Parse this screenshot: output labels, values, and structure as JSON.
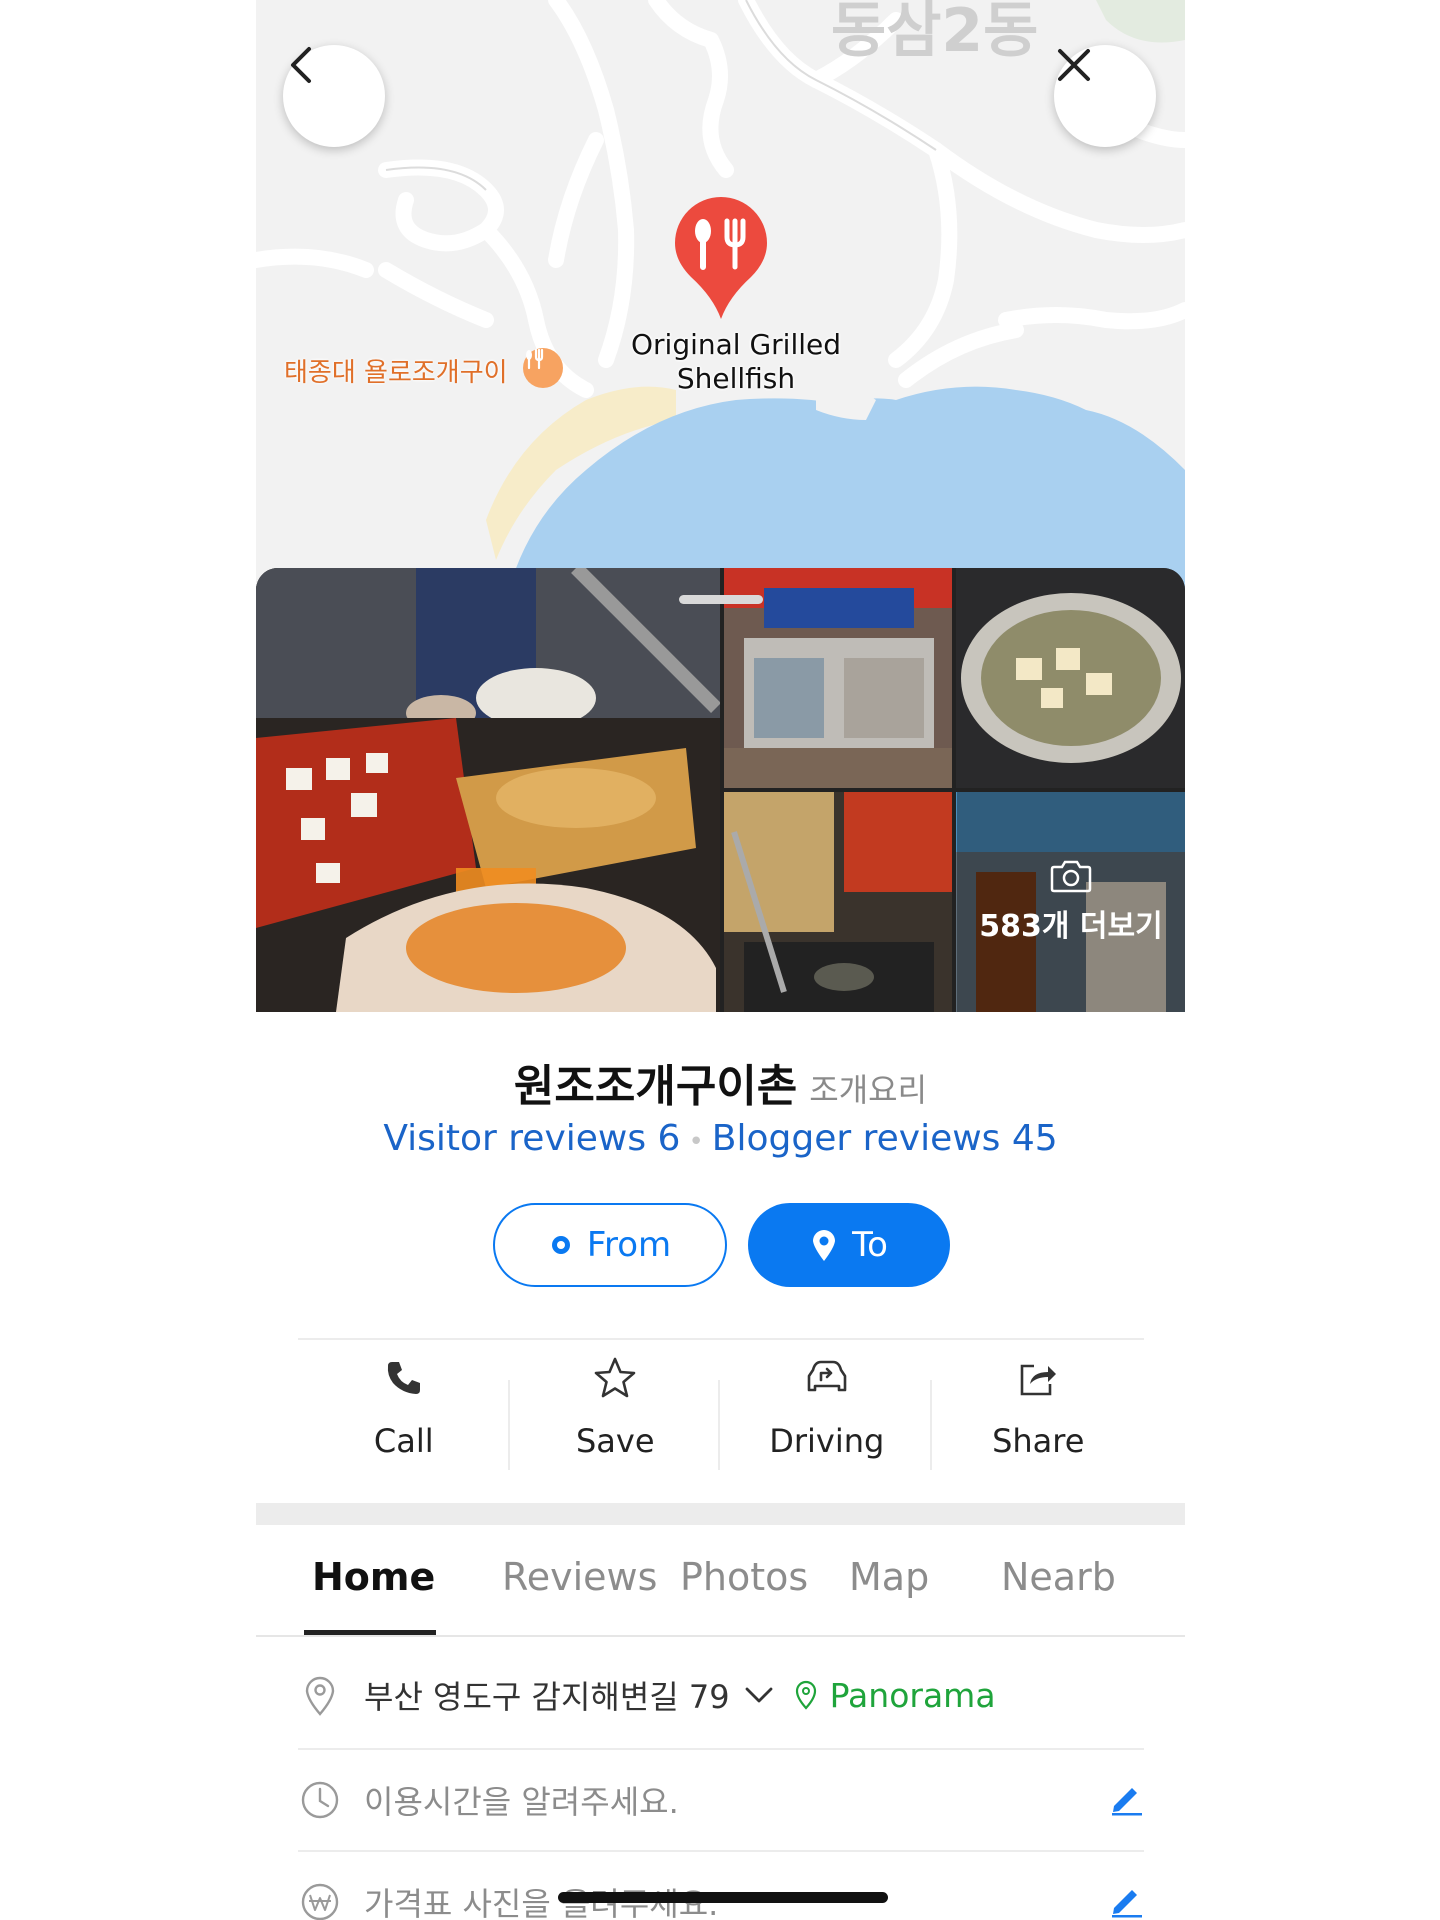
{
  "map": {
    "area_label": "동삼2동",
    "pin_label": "Original Grilled Shellfish",
    "poi_label": "태종대 욜로조개구이",
    "accent_pin_color": "#ec4a3e",
    "poi_color": "#e0702a"
  },
  "gallery": {
    "more_label": "583개 더보기"
  },
  "place": {
    "name": "원조조개구이촌",
    "category": "조개요리",
    "visitor_reviews": "Visitor reviews 6",
    "blogger_reviews": "Blogger reviews 45"
  },
  "route": {
    "from_label": "From",
    "to_label": "To",
    "accent": "#0a79f1"
  },
  "actions": [
    {
      "label": "Call",
      "icon": "phone-icon"
    },
    {
      "label": "Save",
      "icon": "star-icon"
    },
    {
      "label": "Driving",
      "icon": "car-route-icon"
    },
    {
      "label": "Share",
      "icon": "share-icon"
    }
  ],
  "tabs": [
    {
      "label": "Home",
      "active": true
    },
    {
      "label": "Reviews",
      "active": false
    },
    {
      "label": "Photos",
      "active": false
    },
    {
      "label": "Map",
      "active": false
    },
    {
      "label": "Nearb",
      "active": false
    }
  ],
  "info": {
    "address": "부산 영도구 감지해변길 79",
    "panorama": "Panorama",
    "hours_prompt": "이용시간을 알려주세요.",
    "price_prompt": "가격표 사진을 올려주세요."
  }
}
